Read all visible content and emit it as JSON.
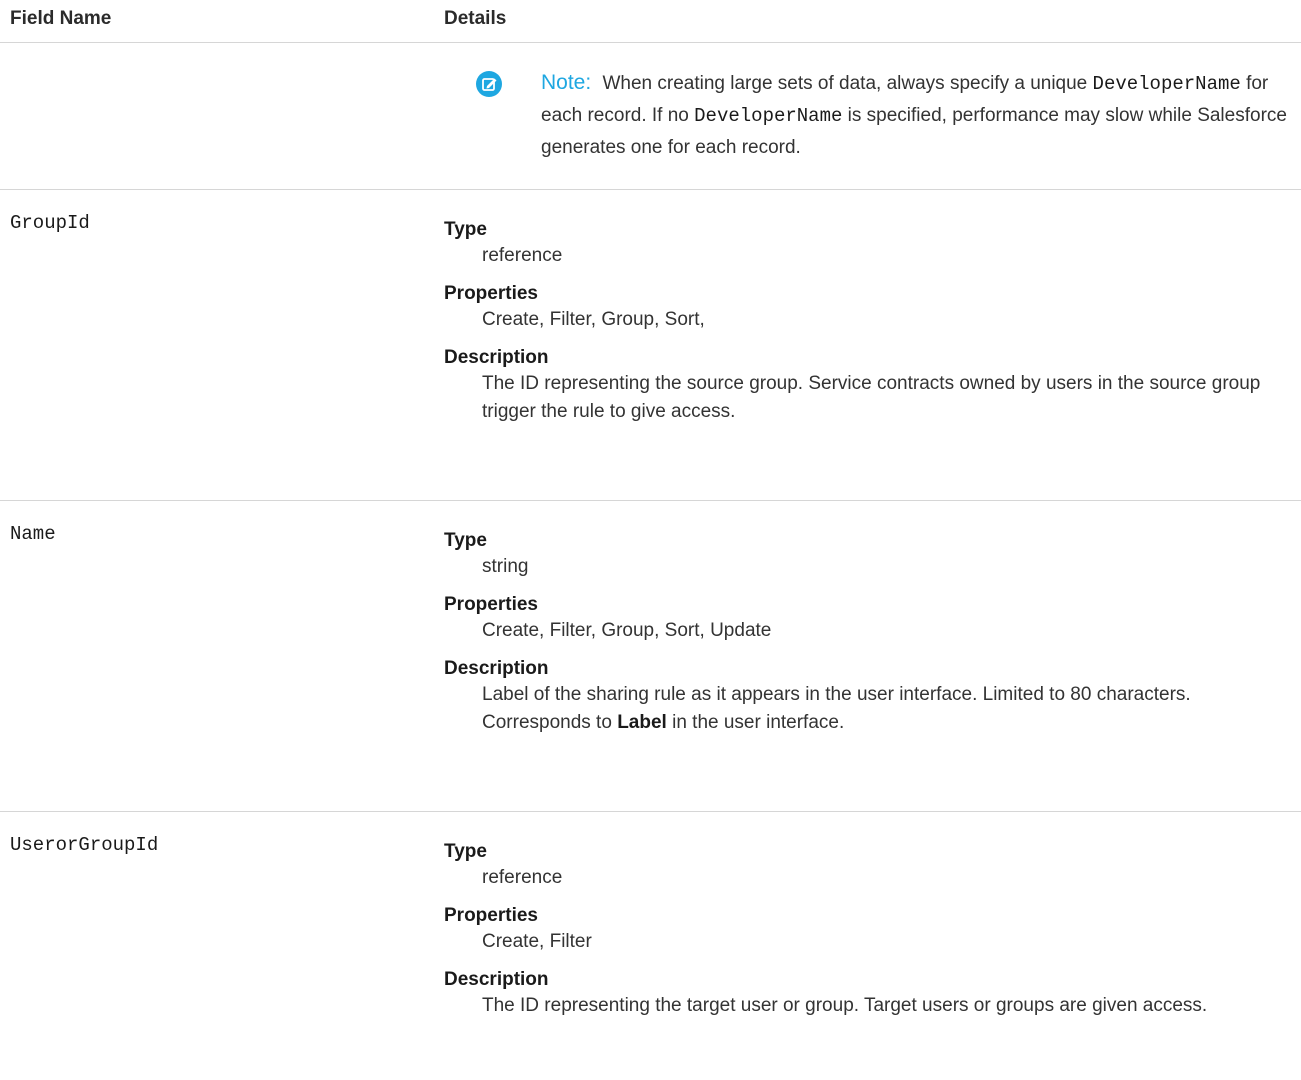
{
  "header": {
    "field_name": "Field Name",
    "details": "Details"
  },
  "note": {
    "label": "Note:",
    "text_1": "When creating large sets of data, always specify a unique",
    "code_1": "DeveloperName",
    "text_2": "for each record. If no",
    "code_2": "DeveloperName",
    "text_3": "is specified, performance may slow while Salesforce generates one for each record."
  },
  "fields": [
    {
      "name": "GroupId",
      "type_label": "Type",
      "type": "reference",
      "properties_label": "Properties",
      "properties": "Create, Filter, Group, Sort,",
      "description_label": "Description",
      "description": "The ID representing the source group. Service contracts owned by users in the source group trigger the rule to give access."
    },
    {
      "name": "Name",
      "type_label": "Type",
      "type": "string",
      "properties_label": "Properties",
      "properties": "Create, Filter, Group, Sort, Update",
      "description_label": "Description",
      "description_pre": "Label of the sharing rule as it appears in the user interface. Limited to 80 characters. Corresponds to",
      "description_bold": "Label",
      "description_post": "in the user interface."
    },
    {
      "name": "UserorGroupId",
      "type_label": "Type",
      "type": "reference",
      "properties_label": "Properties",
      "properties": "Create, Filter",
      "description_label": "Description",
      "description": "The ID representing the target user or group. Target users or groups are given access."
    }
  ]
}
